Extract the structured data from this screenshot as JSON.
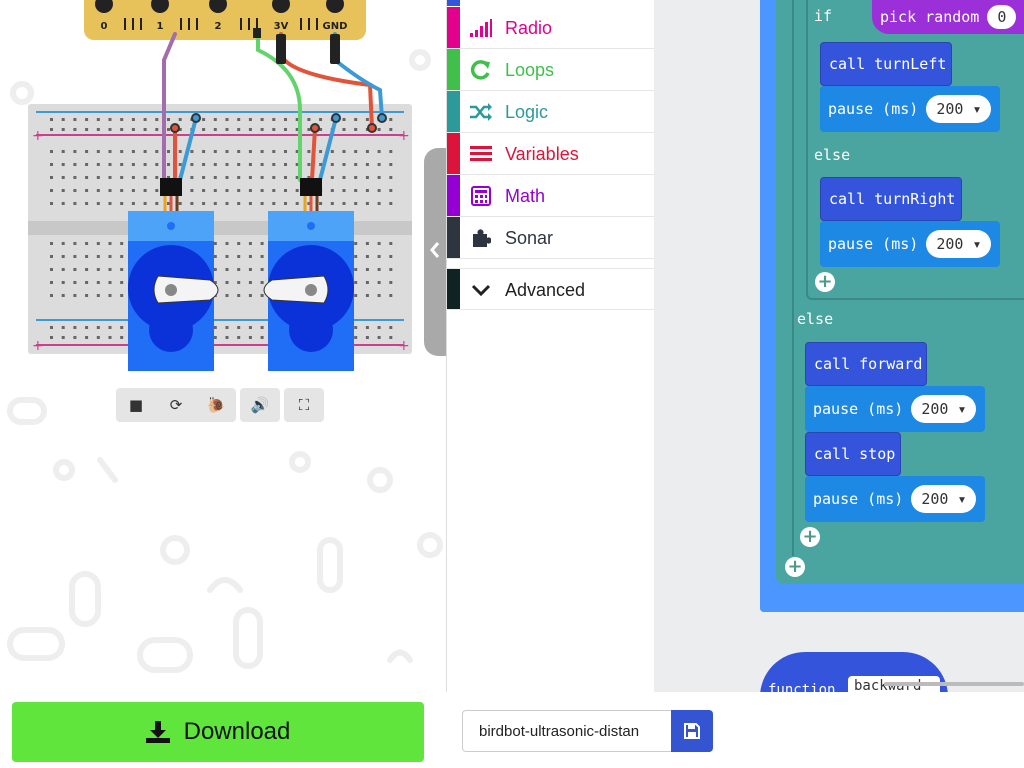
{
  "simulator": {
    "pin_labels": [
      "0",
      "1",
      "2",
      "3V",
      "GND"
    ],
    "controls": [
      "stop-icon",
      "restart-icon",
      "slow-mo-icon",
      "mute-icon",
      "fullscreen-icon"
    ]
  },
  "toolbox": {
    "items": [
      {
        "label": "Radio",
        "color": "#e3008c",
        "icon": "signal-bars-icon"
      },
      {
        "label": "Loops",
        "color": "#40bf4a",
        "icon": "loop-arrow-icon"
      },
      {
        "label": "Logic",
        "color": "#2c9a9a",
        "icon": "shuffle-icon"
      },
      {
        "label": "Variables",
        "color": "#dc143c",
        "icon": "list-lines-icon"
      },
      {
        "label": "Math",
        "color": "#9400d3",
        "icon": "calculator-icon"
      },
      {
        "label": "Sonar",
        "color": "#2e3440",
        "icon": "puzzle-icon"
      },
      {
        "label": "Advanced",
        "color": "#0f2322",
        "icon": "chevron-down-icon"
      }
    ]
  },
  "blocks": {
    "if_label": "if",
    "pick_random": "pick random",
    "pick_random_min": "0",
    "call_turnleft": "call turnLeft",
    "pause1": "pause (ms)",
    "pause1_val": "200",
    "else1": "else",
    "call_turnright": "call turnRight",
    "pause2": "pause (ms)",
    "pause2_val": "200",
    "else2": "else",
    "call_forward": "call forward",
    "pause3": "pause (ms)",
    "pause3_val": "200",
    "call_stop": "call stop",
    "pause4": "pause (ms)",
    "pause4_val": "200",
    "function_label": "function",
    "function_name": "backward"
  },
  "bottom": {
    "download_label": "Download",
    "project_name": "birdbot-ultrasonic-distan"
  }
}
